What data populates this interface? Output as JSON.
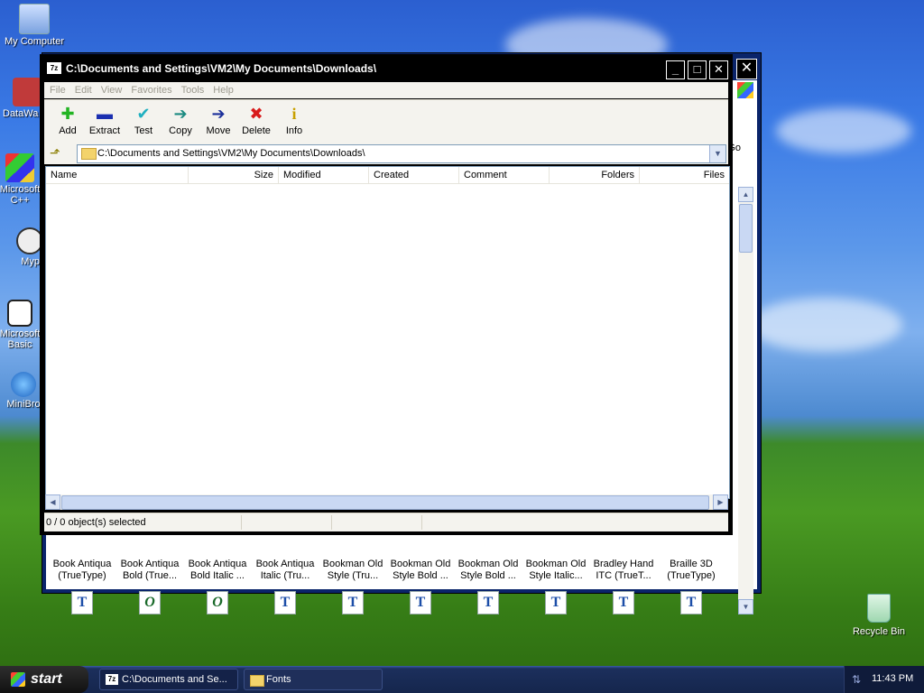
{
  "desktop": {
    "icons": [
      {
        "label": "My Computer"
      },
      {
        "label": "DataWa"
      },
      {
        "label": "Microsoft C++"
      },
      {
        "label": "Myp"
      },
      {
        "label": "Microsoft Basic"
      },
      {
        "label": "MiniBro"
      }
    ],
    "recycle_bin": "Recycle Bin"
  },
  "fonts_window": {
    "go_label": "Go",
    "fonts": [
      {
        "name": "Book Antiqua (TrueType)",
        "glyph": "T"
      },
      {
        "name": "Book Antiqua Bold (True...",
        "glyph": "O"
      },
      {
        "name": "Book Antiqua Bold Italic ...",
        "glyph": "O"
      },
      {
        "name": "Book Antiqua Italic (Tru...",
        "glyph": "T"
      },
      {
        "name": "Bookman Old Style (Tru...",
        "glyph": "T"
      },
      {
        "name": "Bookman Old Style Bold ...",
        "glyph": "T"
      },
      {
        "name": "Bookman Old Style Bold ...",
        "glyph": "T"
      },
      {
        "name": "Bookman Old Style Italic...",
        "glyph": "T"
      },
      {
        "name": "Bradley Hand ITC (TrueT...",
        "glyph": "T"
      },
      {
        "name": "Braille 3D (TrueType)",
        "glyph": "T"
      }
    ]
  },
  "window": {
    "title": "C:\\Documents and Settings\\VM2\\My Documents\\Downloads\\",
    "app_icon": "7z",
    "menu": [
      "File",
      "Edit",
      "View",
      "Favorites",
      "Tools",
      "Help"
    ],
    "toolbar": [
      {
        "label": "Add",
        "icon": "plus-icon",
        "glyph": "✚",
        "color": "#22b422"
      },
      {
        "label": "Extract",
        "icon": "minus-icon",
        "glyph": "▬",
        "color": "#1a2fb0"
      },
      {
        "label": "Test",
        "icon": "check-icon",
        "glyph": "✔",
        "color": "#20b0c0"
      },
      {
        "label": "Copy",
        "icon": "arrow-right-icon",
        "glyph": "➔",
        "color": "#1a8a80"
      },
      {
        "label": "Move",
        "icon": "arrow-right-icon",
        "glyph": "➔",
        "color": "#1a2f9a"
      },
      {
        "label": "Delete",
        "icon": "x-icon",
        "glyph": "✖",
        "color": "#d81a1a"
      },
      {
        "label": "Info",
        "icon": "info-icon",
        "glyph": "i",
        "color": "#c8a000"
      }
    ],
    "address": "C:\\Documents and Settings\\VM2\\My Documents\\Downloads\\",
    "columns": [
      "Name",
      "Size",
      "Modified",
      "Created",
      "Comment",
      "Folders",
      "Files"
    ],
    "status": "0 / 0 object(s) selected"
  },
  "taskbar": {
    "start": "start",
    "tasks": [
      {
        "label": "C:\\Documents and Se...",
        "icon": "7z"
      },
      {
        "label": "Fonts",
        "icon": "folder"
      }
    ],
    "clock": "11:43 PM"
  }
}
